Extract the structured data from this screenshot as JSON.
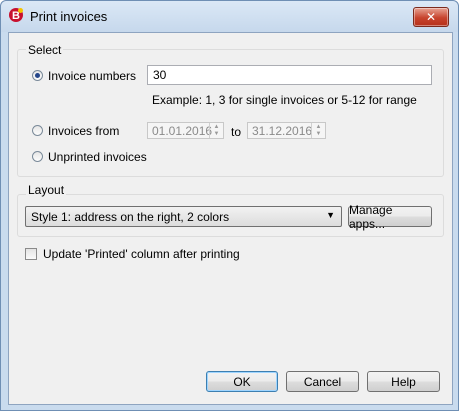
{
  "window": {
    "title": "Print invoices",
    "close_glyph": "✕"
  },
  "select_group": {
    "title": "Select",
    "invoice_numbers": {
      "label": "Invoice numbers",
      "value": "30",
      "checked": true
    },
    "example_text": "Example: 1, 3 for single invoices or 5-12 for range",
    "invoices_from": {
      "label": "Invoices from",
      "from": "01.01.2016",
      "to_label": "to",
      "to": "31.12.2016",
      "checked": false
    },
    "unprinted": {
      "label": "Unprinted invoices",
      "checked": false
    }
  },
  "layout_group": {
    "title": "Layout",
    "style_selected": "Style 1: address on the right, 2 colors",
    "manage_apps_label": "Manage apps..."
  },
  "update_printed": {
    "label": "Update 'Printed' column after printing",
    "checked": false
  },
  "buttons": {
    "ok": "OK",
    "cancel": "Cancel",
    "help": "Help"
  },
  "icons": {
    "app": "banana-app-icon",
    "close": "close-icon",
    "dropdown": "chevron-down-icon"
  }
}
